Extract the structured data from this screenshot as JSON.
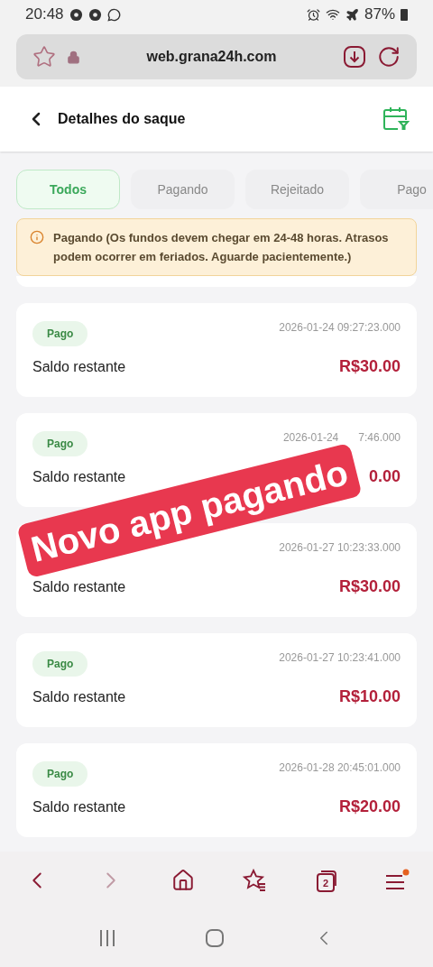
{
  "status_bar": {
    "time": "20:48",
    "battery": "87%"
  },
  "browser": {
    "url": "web.grana24h.com",
    "tab_count": "2"
  },
  "header": {
    "title": "Detalhes do saque"
  },
  "tabs": [
    {
      "label": "Todos",
      "selected": true
    },
    {
      "label": "Pagando",
      "selected": false
    },
    {
      "label": "Rejeitado",
      "selected": false
    },
    {
      "label": "Pago",
      "selected": false
    }
  ],
  "notice": "Pagando (Os fundos devem chegar em 24-48 horas. Atrasos podem ocorrer em feriados. Aguarde pacientemente.)",
  "records": [
    {
      "badge": "Pago",
      "date_parts": [
        "2026-01-24 09:27:23.000"
      ],
      "label": "Saldo restante",
      "amount": "R$30.00"
    },
    {
      "badge": "Pago",
      "date_parts": [
        "2026-01-24",
        "7:46.000"
      ],
      "label": "Saldo restante",
      "amount": "0.00"
    },
    {
      "date_parts": [
        "2026-01-27 10:23:33.000"
      ],
      "label": "Saldo restante",
      "amount": "R$30.00"
    },
    {
      "badge": "Pago",
      "date_parts": [
        "2026-01-27 10:23:41.000"
      ],
      "label": "Saldo restante",
      "amount": "R$10.00"
    },
    {
      "badge": "Pago",
      "date_parts": [
        "2026-01-28 20:45:01.000"
      ],
      "label": "Saldo restante",
      "amount": "R$20.00"
    }
  ],
  "overlay_caption": "Novo app pagando"
}
